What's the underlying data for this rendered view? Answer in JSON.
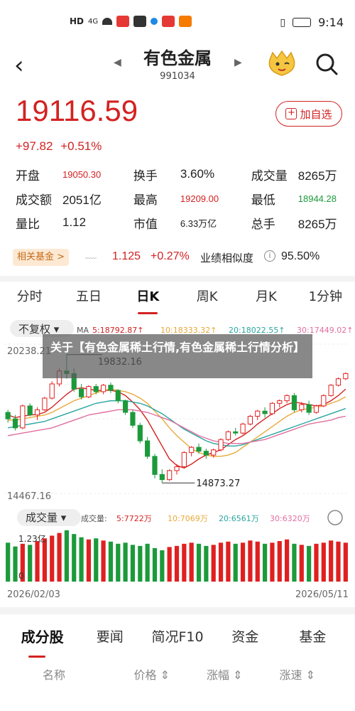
{
  "status_bar": {
    "network": "HD",
    "signal": "4G",
    "time": "9:14"
  },
  "header": {
    "title": "有色金属",
    "code": "991034",
    "back_icon": "chevron-left-icon",
    "search_icon": "search-icon"
  },
  "quote": {
    "price": "19116.59",
    "change": "+97.82",
    "change_pct": "+0.51%",
    "add_fav_label": "加自选",
    "rows": [
      [
        {
          "label": "开盘",
          "value": "19050.30",
          "cls": "red small"
        },
        {
          "label": "换手",
          "value": "3.60%",
          "cls": ""
        },
        {
          "label": "成交量",
          "value": "8265万",
          "cls": ""
        }
      ],
      [
        {
          "label": "成交额",
          "value": "2051亿",
          "cls": ""
        },
        {
          "label": "最高",
          "value": "19209.00",
          "cls": "red small"
        },
        {
          "label": "最低",
          "value": "18944.28",
          "cls": "green small"
        }
      ],
      [
        {
          "label": "量比",
          "value": "1.12",
          "cls": ""
        },
        {
          "label": "市值",
          "value": "6.33万亿",
          "cls": "small"
        },
        {
          "label": "总手",
          "value": "8265万",
          "cls": ""
        }
      ]
    ]
  },
  "fund": {
    "tag": "相关基金 >",
    "price": "1.125",
    "change": "+0.27%",
    "similarity_label": "业绩相似度",
    "similarity_value": "95.50%"
  },
  "kline_tabs": [
    "分时",
    "五日",
    "日K",
    "周K",
    "月K",
    "1分钟"
  ],
  "kline_active": 2,
  "chart": {
    "adjust_label": "不复权",
    "ma_legend": [
      "MA",
      "5:18792.87↑",
      "10:18333.32↑",
      "20:18022.55↑",
      "30:17449.02↑"
    ],
    "ma_colors": [
      "#d32222",
      "#e8a93a",
      "#2aa6a0",
      "#e06fa0"
    ],
    "y_top_label": "20238.21",
    "y_bottom_label": "14467.16",
    "high_annotation": "19832.16",
    "low_annotation": "14873.27",
    "volume_label": "成交量",
    "vol_legend": [
      "成交量:",
      "5:7722万",
      "10:7069万",
      "20:6561万",
      "30:6320万"
    ],
    "vol_scale_label": "1.23亿",
    "vol_zero_label": "0",
    "date_start": "2026/02/03",
    "date_end": "2026/05/11"
  },
  "overlay_text": "关于【有色金属稀土行情,有色金属稀土行情分析】",
  "bottom_tabs": [
    "成分股",
    "要闻",
    "简况F10",
    "资金",
    "基金"
  ],
  "list_columns": [
    "名称",
    "价格",
    "涨幅",
    "涨速"
  ],
  "chart_data": {
    "type": "candlestick",
    "x": [
      "2026/02/03",
      "2026/05/11"
    ],
    "ylim": [
      14467.16,
      20238.21
    ],
    "annotations": [
      {
        "label": "19832.16",
        "kind": "high"
      },
      {
        "label": "14873.27",
        "kind": "low"
      }
    ],
    "candles": [
      [
        17600,
        17700,
        17200,
        17350
      ],
      [
        17350,
        17500,
        16900,
        17000
      ],
      [
        17000,
        17900,
        16950,
        17850
      ],
      [
        17850,
        17950,
        17450,
        17500
      ],
      [
        17500,
        17800,
        17300,
        17700
      ],
      [
        17700,
        18200,
        17650,
        18150
      ],
      [
        18150,
        18800,
        18100,
        18700
      ],
      [
        18700,
        19300,
        18600,
        19200
      ],
      [
        19200,
        19832,
        18900,
        19100
      ],
      [
        19100,
        19300,
        18400,
        18500
      ],
      [
        18500,
        18700,
        18100,
        18200
      ],
      [
        18200,
        18650,
        18150,
        18600
      ],
      [
        18600,
        18700,
        18300,
        18400
      ],
      [
        18400,
        18700,
        18300,
        18650
      ],
      [
        18650,
        18750,
        18350,
        18450
      ],
      [
        18450,
        18500,
        17950,
        18050
      ],
      [
        18050,
        18100,
        17500,
        17600
      ],
      [
        17600,
        17700,
        17000,
        17100
      ],
      [
        17100,
        17200,
        16400,
        16500
      ],
      [
        16500,
        16650,
        15800,
        15900
      ],
      [
        15900,
        16000,
        15050,
        15200
      ],
      [
        15200,
        15400,
        14873,
        15000
      ],
      [
        15000,
        15400,
        14950,
        15350
      ],
      [
        15350,
        15600,
        15200,
        15500
      ],
      [
        15500,
        16100,
        15450,
        16050
      ],
      [
        16050,
        16300,
        15900,
        16250
      ],
      [
        16250,
        16400,
        16000,
        16100
      ],
      [
        16100,
        16200,
        15800,
        15950
      ],
      [
        15950,
        16200,
        15850,
        16150
      ],
      [
        16150,
        16600,
        16100,
        16550
      ],
      [
        16550,
        16900,
        16500,
        16850
      ],
      [
        16850,
        17000,
        16700,
        16800
      ],
      [
        16800,
        17200,
        16750,
        17150
      ],
      [
        17150,
        17500,
        17100,
        17450
      ],
      [
        17450,
        17700,
        17300,
        17650
      ],
      [
        17650,
        17800,
        17400,
        17550
      ],
      [
        17550,
        18000,
        17500,
        17950
      ],
      [
        17950,
        18100,
        17800,
        18050
      ],
      [
        18050,
        18300,
        17950,
        18250
      ],
      [
        18250,
        18350,
        17600,
        17700
      ],
      [
        17700,
        18000,
        17600,
        17900
      ],
      [
        17900,
        18050,
        17500,
        17600
      ],
      [
        17600,
        17900,
        17550,
        17850
      ],
      [
        17850,
        18300,
        17800,
        18250
      ],
      [
        18250,
        18700,
        18200,
        18650
      ],
      [
        18650,
        18950,
        18600,
        18900
      ],
      [
        18900,
        19150,
        18850,
        19100
      ]
    ],
    "volumes": [
      0.72,
      0.65,
      0.7,
      0.68,
      0.75,
      0.8,
      0.85,
      0.9,
      0.95,
      0.88,
      0.82,
      0.78,
      0.8,
      0.76,
      0.74,
      0.7,
      0.72,
      0.68,
      0.66,
      0.7,
      0.62,
      0.58,
      0.64,
      0.66,
      0.7,
      0.72,
      0.7,
      0.66,
      0.68,
      0.72,
      0.74,
      0.7,
      0.72,
      0.76,
      0.74,
      0.7,
      0.72,
      0.75,
      0.78,
      0.7,
      0.68,
      0.66,
      0.7,
      0.72,
      0.76,
      0.74,
      0.72
    ],
    "ma5": [
      17500,
      17400,
      17450,
      17500,
      17520,
      17600,
      17800,
      18050,
      18300,
      18500,
      18550,
      18500,
      18450,
      18450,
      18450,
      18400,
      18250,
      18000,
      17700,
      17300,
      16800,
      16300,
      15800,
      15550,
      15450,
      15600,
      15800,
      15950,
      16050,
      16150,
      16350,
      16550,
      16700,
      16900,
      17150,
      17350,
      17550,
      17750,
      17900,
      18000,
      17950,
      17900,
      17850,
      17900,
      18050,
      18250,
      18500
    ],
    "ma10": [
      17300,
      17300,
      17350,
      17400,
      17450,
      17500,
      17600,
      17750,
      17900,
      18050,
      18150,
      18250,
      18350,
      18450,
      18500,
      18450,
      18400,
      18300,
      18150,
      17950,
      17650,
      17350,
      17000,
      16700,
      16450,
      16200,
      16050,
      15950,
      15900,
      15900,
      15950,
      16050,
      16250,
      16450,
      16650,
      16850,
      17050,
      17250,
      17450,
      17600,
      17700,
      17750,
      17800,
      17850,
      17950,
      18050,
      18200
    ],
    "ma20": [
      17000,
      17050,
      17100,
      17150,
      17200,
      17250,
      17350,
      17450,
      17550,
      17650,
      17750,
      17850,
      17950,
      18000,
      18050,
      18050,
      18050,
      18000,
      17950,
      17850,
      17700,
      17550,
      17350,
      17150,
      16950,
      16800,
      16650,
      16500,
      16400,
      16350,
      16300,
      16300,
      16350,
      16450,
      16550,
      16650,
      16750,
      16850,
      16950,
      17050,
      17150,
      17250,
      17350,
      17450,
      17550,
      17650,
      17750
    ],
    "ma30": [
      16700,
      16750,
      16800,
      16850,
      16900,
      16950,
      17000,
      17100,
      17200,
      17300,
      17400,
      17500,
      17550,
      17600,
      17650,
      17700,
      17700,
      17700,
      17650,
      17600,
      17500,
      17400,
      17300,
      17150,
      17000,
      16850,
      16700,
      16600,
      16500,
      16450,
      16400,
      16400,
      16400,
      16450,
      16500,
      16550,
      16650,
      16750,
      16850,
      16950,
      17050,
      17150,
      17200,
      17250,
      17300,
      17400,
      17450
    ]
  }
}
